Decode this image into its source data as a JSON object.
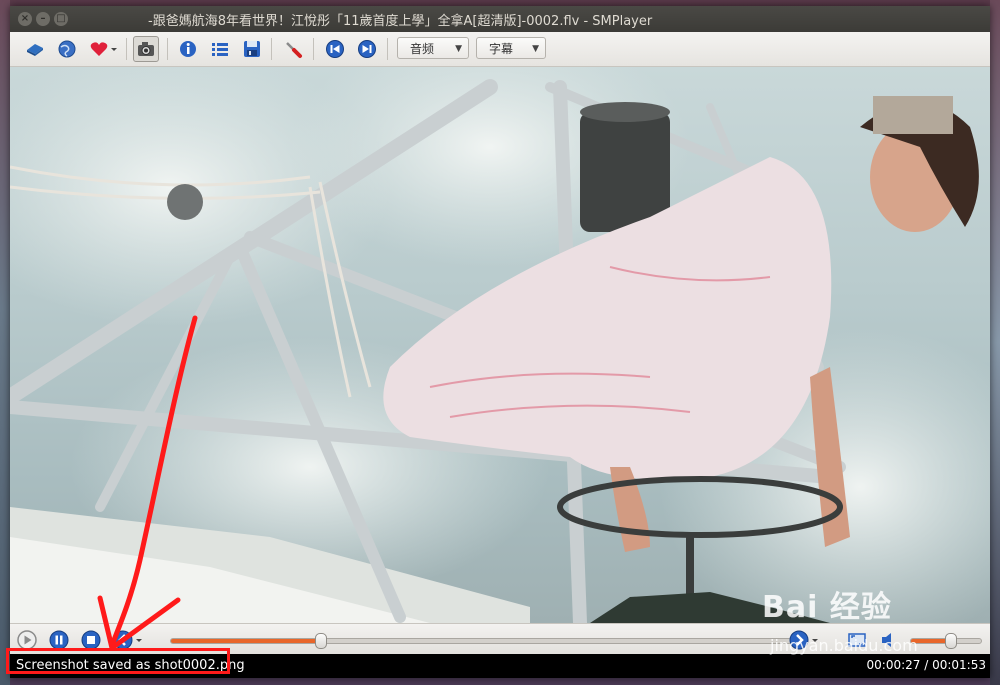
{
  "window": {
    "title": "-跟爸媽航海8年看世界！江悅彤「11歲首度上學」全拿A[超清版]-0002.flv - SMPlayer"
  },
  "toolbar": {
    "audio_label": "音频",
    "subtitle_label": "字幕"
  },
  "playback": {
    "progress_percent": 24,
    "volume_percent": 55
  },
  "status": {
    "message": "Screenshot saved as shot0002.png",
    "time": "00:00:27 / 00:01:53"
  },
  "watermark": {
    "brand": "Bai 经验",
    "url": "jingyan.baidu.com"
  },
  "colors": {
    "accent": "#e8662a",
    "annotation": "#ff1a1a",
    "titlebar": "#3c3b37"
  }
}
